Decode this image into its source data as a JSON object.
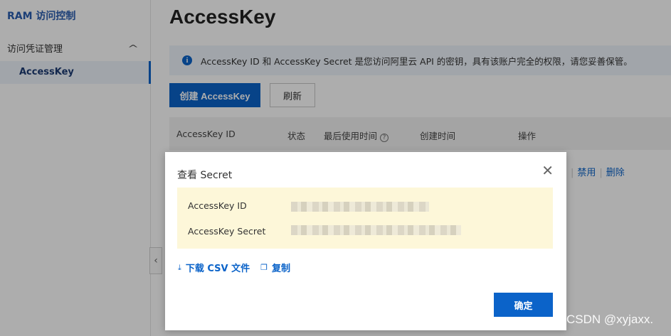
{
  "sidebar": {
    "brand": "RAM 访问控制",
    "group_label": "访问凭证管理",
    "active_item": "AccessKey"
  },
  "main": {
    "title": "AccessKey",
    "info": "AccessKey ID 和 AccessKey Secret 是您访问阿里云 API 的密钥，具有该账户完全的权限，请您妥善保管。",
    "create_button": "创建 AccessKey",
    "refresh_button": "刷新",
    "table": {
      "columns": [
        "AccessKey ID",
        "状态",
        "最后使用时间",
        "创建时间",
        "操作"
      ],
      "row_actions": [
        "禁用",
        "删除"
      ]
    }
  },
  "modal": {
    "title": "查看 Secret",
    "fields": [
      {
        "label": "AccessKey ID"
      },
      {
        "label": "AccessKey Secret"
      }
    ],
    "download_link": "下载 CSV 文件",
    "copy_link": "复制",
    "ok_button": "确定"
  },
  "watermark": "CSDN @xyjaxx.",
  "icons": {
    "info": "info-icon",
    "expand": "chevron-up-icon",
    "collapse": "chevron-left-icon",
    "help": "help-circle-icon",
    "close": "close-icon",
    "download": "download-icon",
    "copy": "copy-icon"
  },
  "colors": {
    "primary": "#0b63c9",
    "info_bg": "#eef4fb",
    "secret_bg": "#fdf7d9"
  }
}
